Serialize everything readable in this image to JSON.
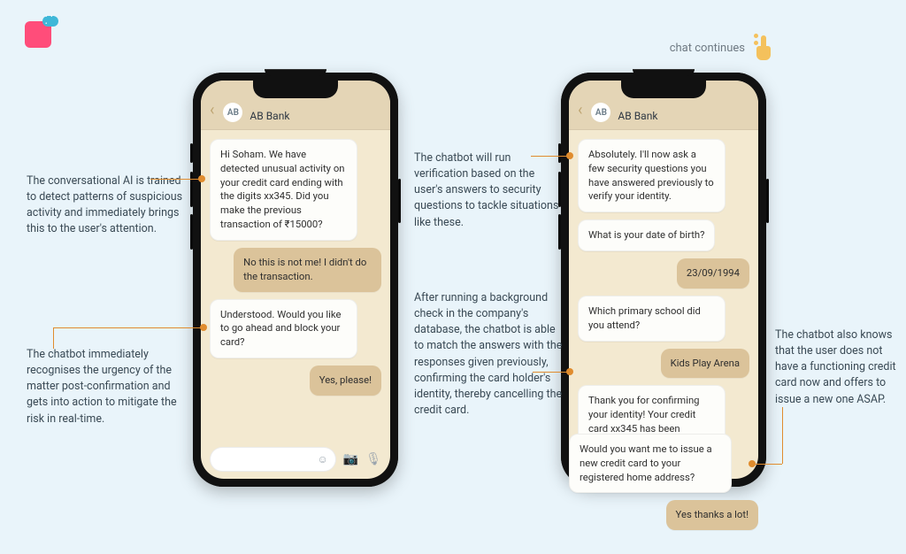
{
  "logo": {
    "name": "brand-logo"
  },
  "continues_label": "chat continues",
  "header": {
    "bank_name": "AB Bank",
    "avatar_initials": "AB"
  },
  "phone1": {
    "messages": [
      {
        "role": "bot",
        "text": "Hi Soham. We have detected unusual activity on your credit card ending with the digits xx345. Did you make the previous transaction of ₹15000?"
      },
      {
        "role": "user",
        "text": "No this is not me! I didn't do the transaction."
      },
      {
        "role": "bot",
        "text": "Understood. Would you like to go ahead and block your card?"
      },
      {
        "role": "user",
        "text": "Yes, please!"
      }
    ],
    "input_placeholder": ""
  },
  "phone2": {
    "messages": [
      {
        "role": "bot",
        "text": "Absolutely. I'll now ask a few security questions you have answered previously to verify your identity."
      },
      {
        "role": "bot",
        "text": "What is your date of birth?"
      },
      {
        "role": "user",
        "text": "23/09/1994"
      },
      {
        "role": "bot",
        "text": "Which primary school did you attend?"
      },
      {
        "role": "user",
        "text": "Kids Play Arena"
      },
      {
        "role": "bot",
        "text": "Thank you for confirming your identity! Your credit card xx345 has been successfully blocked."
      }
    ],
    "overflow_messages": [
      {
        "role": "bot",
        "text": "Would you want me to issue a new credit card to your registered home address?"
      },
      {
        "role": "user",
        "text": "Yes thanks a lot!"
      }
    ]
  },
  "annotations": {
    "a1": "The conversational AI is trained to detect patterns of suspicious activity and immediately brings this to the user's attention.",
    "a2": "The chatbot immediately recognises the urgency of the matter post-confirmation and gets into action to mitigate the risk in real-time.",
    "a3": "The chatbot will run verification based on the user's answers to security questions to tackle situations like these.",
    "a4": "After running a background check in the company's database, the chatbot is able to match the answers with the responses given previously, confirming the card holder's identity, thereby cancelling the credit card.",
    "a5": "The chatbot also knows that the user does not have a functioning credit card now and offers to issue a new one ASAP."
  },
  "chart_data": null
}
